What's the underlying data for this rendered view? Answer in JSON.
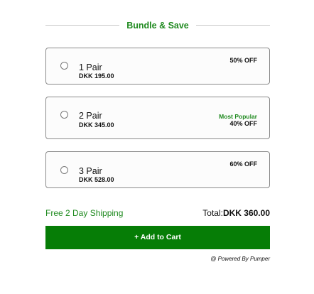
{
  "header": {
    "title": "Bundle & Save"
  },
  "options": [
    {
      "label": "1 Pair",
      "price": "DKK 195.00",
      "badge": "",
      "discount": "50% OFF",
      "selected": false
    },
    {
      "label": "2 Pair",
      "price": "DKK 345.00",
      "badge": "Most Popular",
      "discount": "40% OFF",
      "selected": false
    },
    {
      "label": "3 Pair",
      "price": "DKK 528.00",
      "badge": "",
      "discount": "60% OFF",
      "selected": false
    }
  ],
  "summary": {
    "shipping": "Free 2 Day Shipping",
    "total_label": "Total:",
    "total_value": "DKK 360.00"
  },
  "cart_button": {
    "label": "+ Add to Cart"
  },
  "footer": {
    "powered_by": "@ Powered By Pumper"
  },
  "colors": {
    "accent_green": "#1f8a1f",
    "button_green": "#067d06",
    "border": "#8a8a8a"
  }
}
